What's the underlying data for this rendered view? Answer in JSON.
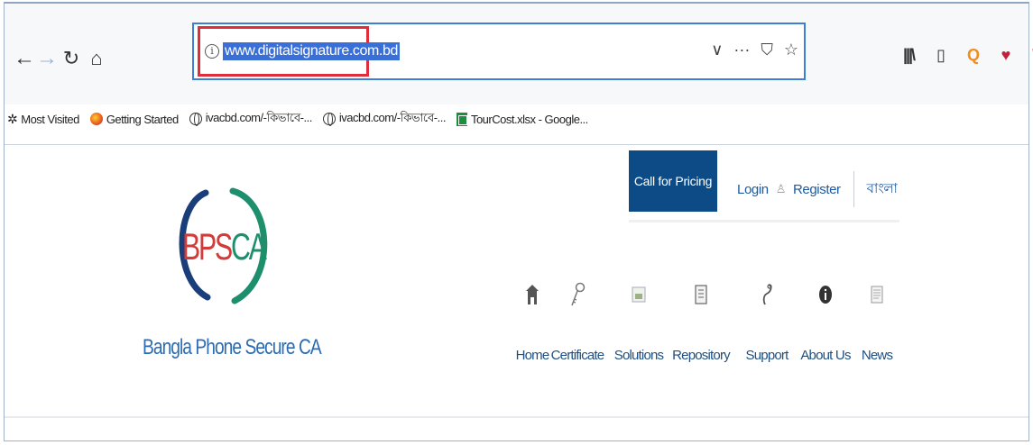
{
  "browser": {
    "url": "www.digitalsignature.com.bd",
    "bookmarks": [
      {
        "label": "Most Visited",
        "icon": "gear-icon"
      },
      {
        "label": "Getting Started",
        "icon": "firefox-icon"
      },
      {
        "label": "ivacbd.com/-কিভাবে-...",
        "icon": "globe-icon"
      },
      {
        "label": "ivacbd.com/-কিভাবে-...",
        "icon": "globe-icon"
      },
      {
        "label": "TourCost.xlsx - Google...",
        "icon": "sheets-icon"
      }
    ],
    "highlight_color": "#e02d3c",
    "selection_color": "#3b6fd8"
  },
  "site": {
    "cta_label": "Call for Pricing",
    "login_label": "Login",
    "register_label": "Register",
    "language_label": "বাংলা",
    "logo_text_b": "BPS",
    "logo_text_c": "CA",
    "brand_name": "Bangla Phone Secure CA",
    "accent_color": "#0d4b86",
    "nav": [
      {
        "label": "Home",
        "icon": "home-icon"
      },
      {
        "label": "Certificate",
        "icon": "key-icon"
      },
      {
        "label": "Solutions",
        "icon": "solutions-icon"
      },
      {
        "label": "Repository",
        "icon": "repository-icon"
      },
      {
        "label": "Support",
        "icon": "support-icon"
      },
      {
        "label": "About Us",
        "icon": "info-icon"
      },
      {
        "label": "News",
        "icon": "news-icon"
      }
    ]
  }
}
